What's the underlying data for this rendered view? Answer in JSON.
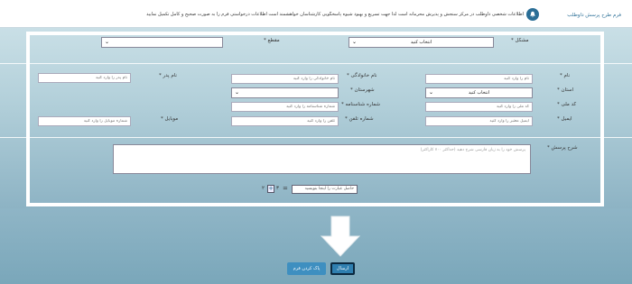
{
  "header": {
    "title": "فرم طرح پرسش داوطلب",
    "notice": "اطلاعات شخصی داوطلب در مرکز سنجش و پذیرش محرمانه است لذا جهت تسریع و بهبود شیوه پاسخگویی کارشناسان خواهشمند است اطلاعات درخواستی فرم را به صورت صحیح و کامل تکمیل نمایید"
  },
  "form": {
    "problem": {
      "label": "مشکل",
      "value": "انتخاب کنید"
    },
    "level": {
      "label": "مقطع",
      "value": ""
    },
    "first_name": {
      "label": "نام",
      "placeholder": "نام را وارد کنید"
    },
    "last_name": {
      "label": "نام خانوادگی",
      "placeholder": "نام خانوادگی را وارد کنید"
    },
    "father_name": {
      "label": "نام پدر",
      "placeholder": "نام پدر را وارد کنید"
    },
    "province": {
      "label": "استان",
      "value": "انتخاب کنید"
    },
    "city": {
      "label": "شهرستان",
      "value": ""
    },
    "national_code": {
      "label": "کد ملی",
      "placeholder": "کد ملی را وارد کنید"
    },
    "id_number": {
      "label": "شماره شناسنامه",
      "placeholder": "شماره شناسنامه را وارد کنید"
    },
    "email": {
      "label": "ایمیل",
      "placeholder": "ایمیل معتبر را وارد کنید"
    },
    "phone": {
      "label": "شماره تلفن",
      "placeholder": "تلفن را وارد کنید"
    },
    "mobile": {
      "label": "موبایل",
      "placeholder": "شماره موبایل را وارد کنید"
    },
    "question": {
      "label": "شرح پرسش",
      "placeholder": "پرسش خود را به زبان فارسی شرح دهید (حداکثر ۷۰۰ کاراکتر)"
    },
    "captcha": {
      "placeholder": "حاصل عبارت را اینجا بنویسید",
      "equals": "=",
      "expr_a": "۳",
      "expr_b": "۲"
    }
  },
  "actions": {
    "submit_label": "ارسال",
    "clear_label": "پاک کردن فرم"
  },
  "colors": {
    "accent": "#2a6e96",
    "submit": "#2f7fb0",
    "clear": "#3e8fc0"
  }
}
